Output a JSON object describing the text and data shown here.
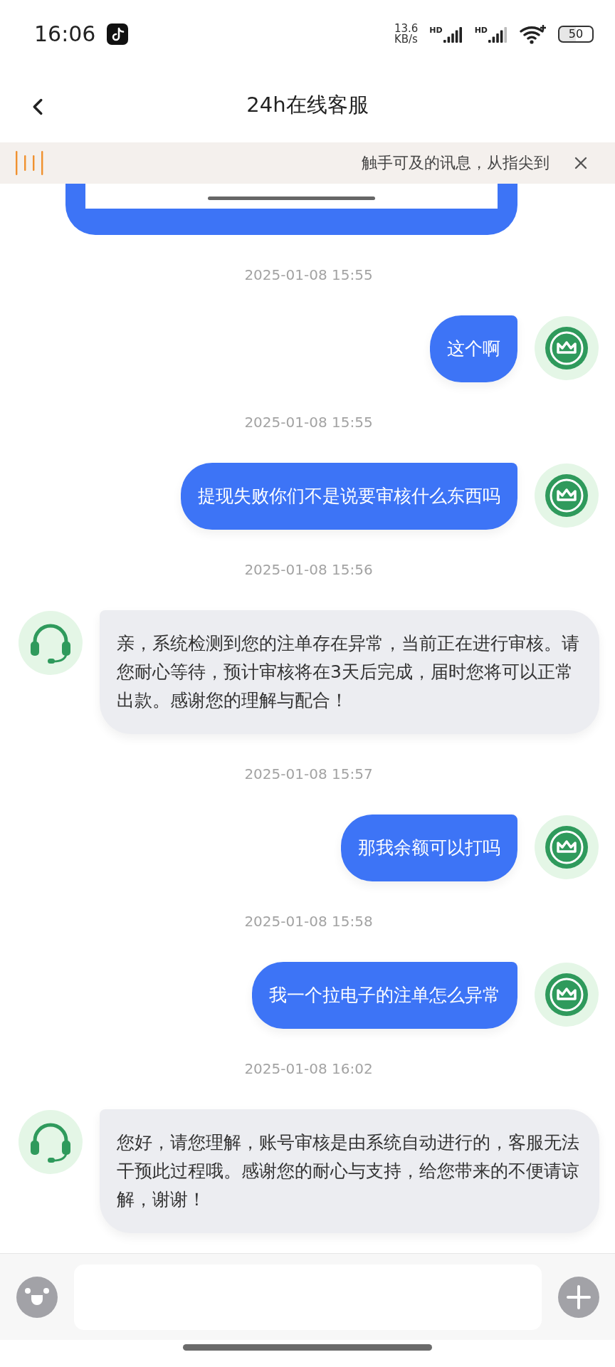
{
  "status_bar": {
    "time": "16:06",
    "net_speed": "13.6",
    "net_unit": "KB/s",
    "sim_labels": [
      "HD",
      "HD"
    ],
    "battery": "50"
  },
  "header": {
    "title": "24h在线客服"
  },
  "notice": {
    "text": "触手可及的讯息，从指尖到"
  },
  "messages": [
    {
      "kind": "image"
    },
    {
      "kind": "user",
      "time": "2025-01-08 15:55",
      "text": "这个啊"
    },
    {
      "kind": "user",
      "time": "2025-01-08 15:55",
      "text": "提现失败你们不是说要审核什么东西吗"
    },
    {
      "kind": "agent",
      "time": "2025-01-08 15:56",
      "text": "亲，系统检测到您的注单存在异常，当前正在进行审核。请您耐心等待，预计审核将在3天后完成，届时您将可以正常出款。感谢您的理解与配合！"
    },
    {
      "kind": "user",
      "time": "2025-01-08 15:57",
      "text": "那我余额可以打吗"
    },
    {
      "kind": "user",
      "time": "2025-01-08 15:58",
      "text": "我一个拉电子的注单怎么异常"
    },
    {
      "kind": "agent",
      "time": "2025-01-08 16:02",
      "text": "您好，请您理解，账号审核是由系统自动进行的，客服无法干预此过程哦。感谢您的耐心与支持，给您带来的不便请谅解，谢谢！"
    }
  ]
}
